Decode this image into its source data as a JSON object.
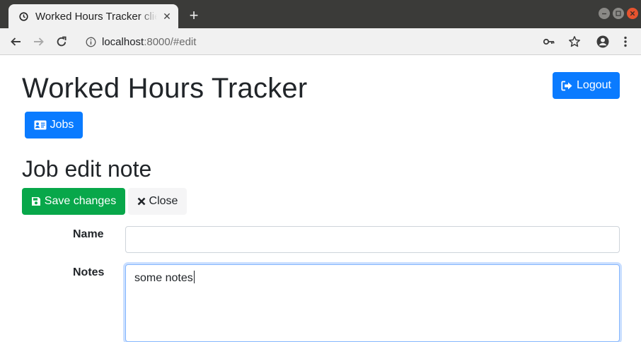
{
  "browser": {
    "tab_title": "Worked Hours Tracker clie",
    "address": {
      "host": "localhost",
      "rest": ":8000/#edit"
    }
  },
  "page": {
    "app_title": "Worked Hours Tracker",
    "logout_label": "Logout",
    "jobs_label": "Jobs",
    "section_title": "Job edit note",
    "save_label": "Save changes",
    "close_label": "Close",
    "form": {
      "name_label": "Name",
      "name_value": "",
      "notes_label": "Notes",
      "notes_value": "some notes"
    }
  },
  "colors": {
    "primary": "#0a7bff",
    "success": "#08a74a",
    "light": "#f5f5f6"
  },
  "icons": {
    "tab": "clock-icon",
    "logout": "sign-out-icon",
    "jobs": "id-card-icon",
    "save": "floppy-disk-icon",
    "close": "times-icon"
  }
}
